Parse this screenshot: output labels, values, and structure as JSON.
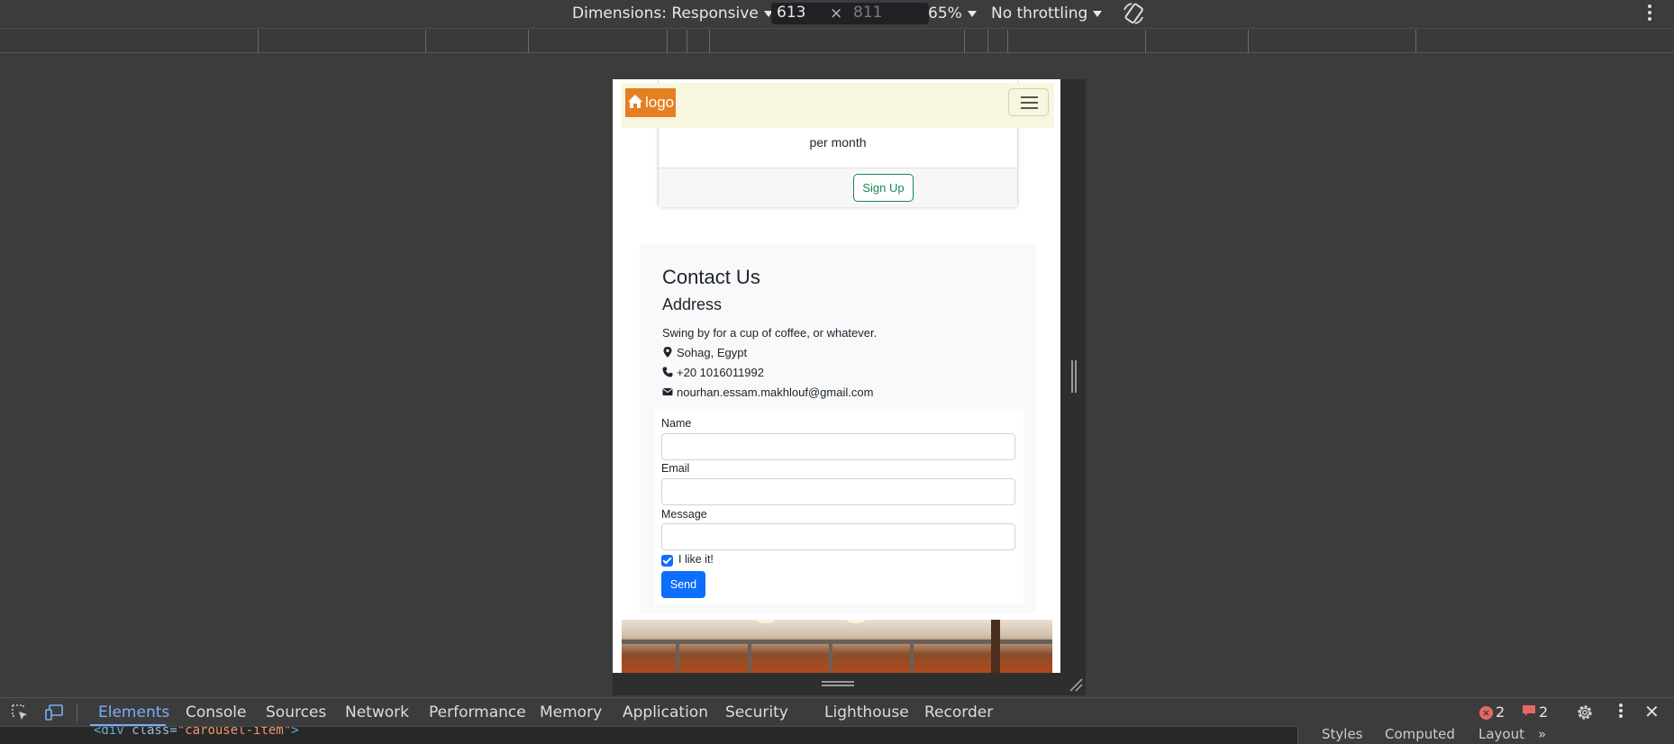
{
  "device_toolbar": {
    "dimensions_label": "Dimensions: Responsive",
    "width": "613",
    "height": "811",
    "times": "×",
    "zoom": "65%",
    "throttling": "No throttling"
  },
  "page": {
    "navbar": {
      "logo": "logo"
    },
    "pricing": {
      "per": "per month",
      "signup": "Sign Up"
    },
    "contact": {
      "title": "Contact Us",
      "subtitle": "Address",
      "tagline": "Swing by for a cup of coffee, or whatever.",
      "location": "Sohag, Egypt",
      "phone": "+20 1016011992",
      "email": "nourhan.essam.makhlouf@gmail.com",
      "form": {
        "name_label": "Name",
        "email_label": "Email",
        "message_label": "Message",
        "checkbox_label": "I like it!",
        "checkbox_checked": true,
        "send": "Send"
      }
    }
  },
  "devtools": {
    "tabs": [
      "Elements",
      "Console",
      "Sources",
      "Network",
      "Performance",
      "Memory",
      "Application",
      "Security",
      "Lighthouse",
      "Recorder"
    ],
    "active_tab": "Elements",
    "errors": "2",
    "warnings": "2",
    "code_tag_open": "<div",
    "code_attr": " class=",
    "code_value": "\"carousel-item\"",
    "code_tag_close": ">",
    "side_tabs": [
      "Styles",
      "Computed",
      "Layout",
      "»"
    ]
  },
  "colors": {
    "active_tab": "#7cacf8",
    "logo_bg": "#e67e22",
    "primary": "#0d6efd",
    "success": "#198754",
    "error": "#e46962"
  }
}
